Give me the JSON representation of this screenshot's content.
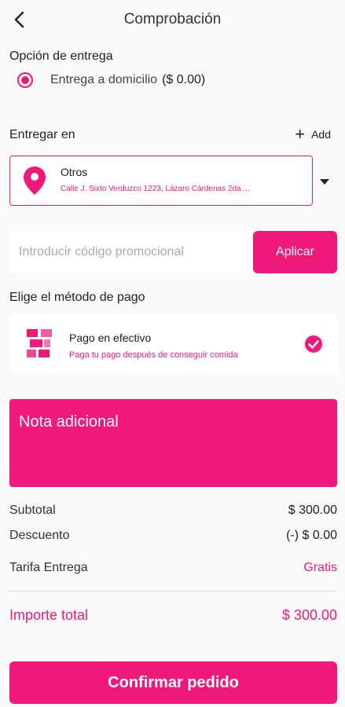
{
  "header": {
    "title": "Comprobación",
    "back_icon": "back-arrow-icon"
  },
  "delivery_option": {
    "label": "Opción de entrega",
    "selected": {
      "text": "Entrega a domicilio",
      "price": "($ 0.00)"
    }
  },
  "deliver_to": {
    "label": "Entregar en",
    "add_label": "Add",
    "address": {
      "title": "Otros",
      "line": "Calle J. Sixto Verduzco 1223, Lázaro Cárdenas 2da ..."
    }
  },
  "promo": {
    "placeholder": "Introducir código promocional",
    "value": "",
    "button_label": "Aplicar"
  },
  "payment": {
    "label": "Elige el método de pago",
    "method": {
      "title": "Pago en efectivo",
      "subtitle": "Paga tu pago después de conseguir comida"
    }
  },
  "note": {
    "placeholder": "Nota adicional"
  },
  "summary": {
    "subtotal_label": "Subtotal",
    "subtotal_value": "$ 300.00",
    "discount_label": "Descuento",
    "discount_value": "(-) $ 0.00",
    "fee_label": "Tarifa Entrega",
    "fee_value": "Gratis",
    "total_label": "Importe total",
    "total_value": "$ 300.00"
  },
  "confirm_label": "Confirmar pedido",
  "colors": {
    "accent": "#f0187a",
    "background": "#fafafa"
  }
}
